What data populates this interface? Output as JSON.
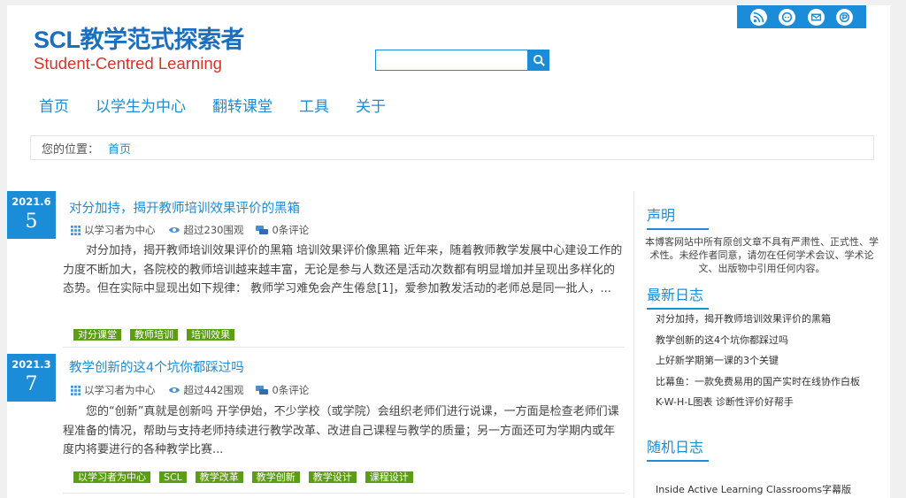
{
  "social": [
    {
      "icon": "rss-icon"
    },
    {
      "icon": "chat-icon"
    },
    {
      "icon": "mail-icon"
    },
    {
      "icon": "weibo-icon"
    }
  ],
  "logo": {
    "title": "SCL教学范式探索者",
    "subtitle": "Student-Centred Learning"
  },
  "search": {
    "placeholder": "",
    "value": ""
  },
  "nav": [
    "首页",
    "以学生为中心",
    "翻转课堂",
    "工具",
    "关于"
  ],
  "breadcrumb": {
    "label": "您的位置：",
    "link": "首页"
  },
  "posts": [
    {
      "date_ym": "2021.6",
      "date_d": "5",
      "title": "对分加持，揭开教师培训效果评价的黑箱",
      "category": "以学习者为中心",
      "views": "超过230围观",
      "comments": "0条评论",
      "excerpt": "对分加持，揭开教师培训效果评价的黑箱 培训效果评价像黑箱 近年来，随着教师教学发展中心建设工作的力度不断加大，各院校的教师培训越来越丰富，无论是参与人数还是活动次数都有明显增加并呈现出多样化的态势。但在实际中显现出如下规律： 教师学习难免会产生倦怠[1]，爱参加教发活动的老师总是同一批人，...",
      "tags": [
        "对分课堂",
        "教师培训",
        "培训效果"
      ]
    },
    {
      "date_ym": "2021.3",
      "date_d": "7",
      "title": "教学创新的这4个坑你都踩过吗",
      "category": "以学习者为中心",
      "views": "超过442围观",
      "comments": "0条评论",
      "excerpt": "您的“创新”真就是创新吗 开学伊始，不少学校（或学院）会组织老师们进行说课，一方面是检查老师们课程准备的情况，帮助与支持老师持续进行教学改革、改进自己课程与教学的质量；另一方面还可为学期内或年度内将要进行的各种教学比赛...",
      "tags": [
        "以学习者为中心",
        "SCL",
        "教学改革",
        "教学创新",
        "教学设计",
        "课程设计"
      ]
    }
  ],
  "sidebar": {
    "notice_title": "声明",
    "notice_text": "本博客网站中所有原创文章不具有严肃性、正式性、学术性。未经作者同意，请勿在任何学术会议、学术论文、出版物中引用任何内容。",
    "latest_title": "最新日志",
    "latest": [
      "对分加持，揭开教师培训效果评价的黑箱",
      "教学创新的这4个坑你都踩过吗",
      "上好新学期第一课的3个关键",
      "比幕鱼：一款免费易用的国产实时在线协作白板",
      "K-W-H-L图表 诊断性评价好帮手"
    ],
    "random_title": "随机日志",
    "random": [
      "Inside Active Learning Classrooms字幕版"
    ]
  }
}
